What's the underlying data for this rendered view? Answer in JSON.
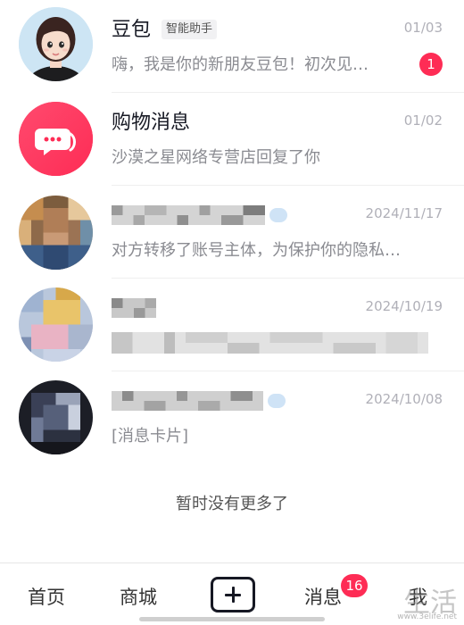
{
  "conversations": [
    {
      "title": "豆包",
      "tag": "智能助手",
      "date": "01/03",
      "preview": "嗨，我是你的新朋友豆包！初次见…",
      "unread": "1",
      "avatar_icon": "ai-assistant-avatar"
    },
    {
      "title": "购物消息",
      "date": "01/02",
      "preview": "沙漠之星网络专营店回复了你",
      "avatar_icon": "chat-bubble-icon",
      "avatar_color": "#fe2c55"
    },
    {
      "date": "2024/11/17",
      "preview": "对方转移了账号主体，为保护你的隐私…",
      "avatar_icon": "pixelated-avatar"
    },
    {
      "date": "2024/10/19",
      "avatar_icon": "pixelated-avatar"
    },
    {
      "date": "2024/10/08",
      "preview": "[消息卡片]",
      "avatar_icon": "pixelated-avatar"
    }
  ],
  "no_more_text": "暂时没有更多了",
  "tabbar": {
    "home": "首页",
    "mall": "商城",
    "messages": "消息",
    "messages_badge": "16",
    "me": "我"
  },
  "watermark": {
    "text": "生活",
    "url": "www.3elife.net"
  },
  "colors": {
    "accent": "#fe2c55",
    "text_primary": "#161823",
    "text_secondary": "#8a8b91"
  }
}
